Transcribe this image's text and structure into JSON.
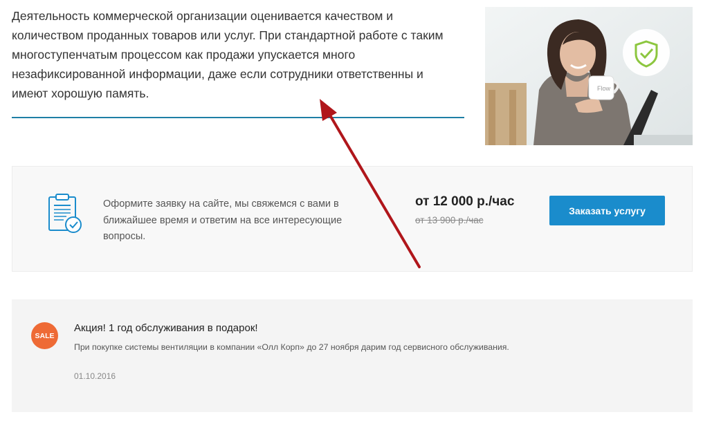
{
  "intro": {
    "text": "Деятельность коммерческой организации оценивается качеством и количеством проданных товаров или услуг. При стандартной работе с таким многоступенчатым процессом как продажи упускается много незафиксированной информации, даже если сотрудники ответственны и имеют хорошую память."
  },
  "hero": {
    "mug_text": "Flow",
    "badge_icon": "shield-check-icon",
    "badge_color": "#8cc63f"
  },
  "order": {
    "icon": "clipboard-check-icon",
    "text": "Оформите заявку на сайте, мы свяжемся с вами в ближайшее время и ответим на все интересующие вопросы.",
    "price": "от 12 000 р./час",
    "old_price": "от 13 900 р./час",
    "button_label": "Заказать услугу",
    "button_color": "#1a8ccc"
  },
  "promo": {
    "badge": "SALE",
    "badge_color": "#ee6a35",
    "title": "Акция! 1 год обслуживания в подарок!",
    "description": "При покупке системы вентиляции в компании «Олл Корп» до 27 ноября дарим год сервисного обслуживания.",
    "date": "01.10.2016"
  },
  "annotation": {
    "arrow_color": "#b0161b"
  }
}
